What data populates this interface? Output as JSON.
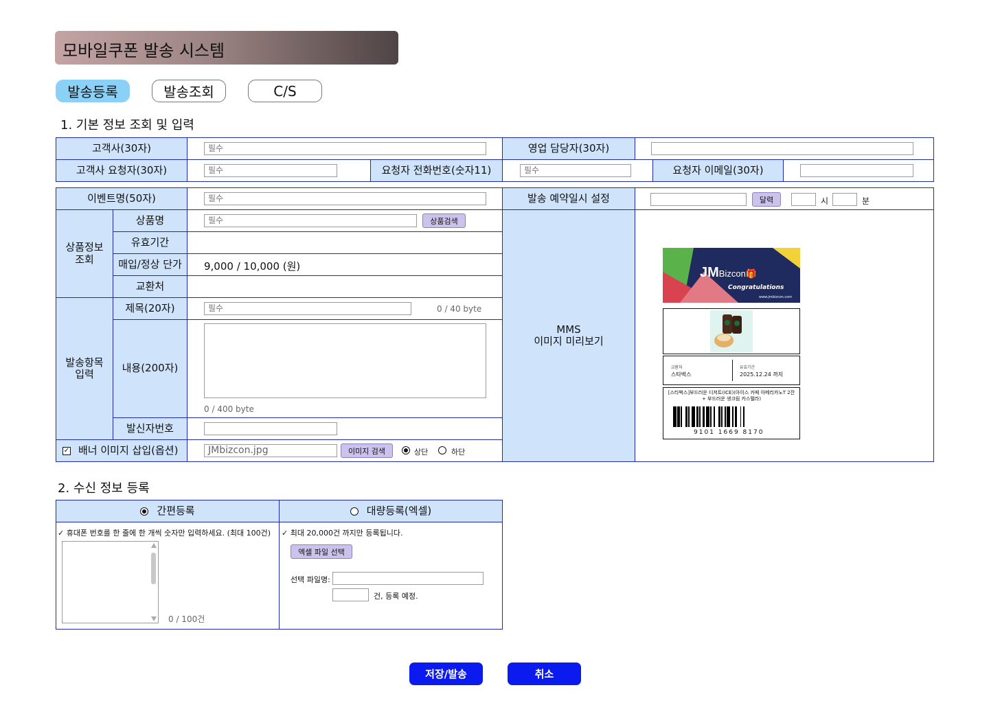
{
  "app": {
    "title": "모바일쿠폰 발송 시스템"
  },
  "tabs": [
    {
      "label": "발송등록",
      "active": true
    },
    {
      "label": "발송조회"
    },
    {
      "label": "C/S"
    }
  ],
  "section1": {
    "title": "1. 기본 정보 조회 및 입력"
  },
  "customer": {
    "company_label": "고객사(30자)",
    "company_placeholder": "필수",
    "sales_label": "영업 담당자(30자)",
    "sales_value": "",
    "requester_label": "고객사 요청자(30자)",
    "requester_placeholder": "필수",
    "phone_label": "요청자 전화번호(숫자11)",
    "phone_placeholder": "필수",
    "email_label": "요청자 이메일(30자)",
    "email_value": ""
  },
  "event": {
    "name_label": "이벤트명(50자)",
    "name_placeholder": "필수",
    "schedule_label": "발송 예약일시 설정",
    "calendar_button": "달력",
    "hour_label": "시",
    "minute_label": "분"
  },
  "product": {
    "group_label": "상품정보\n조회",
    "name_label": "상품명",
    "name_placeholder": "필수",
    "search_button": "상품검색",
    "validity_label": "유효기간",
    "validity_value": "",
    "price_label": "매입/정상 단가",
    "price_value": "9,000 / 10,000 (원)",
    "exchange_label": "교환처",
    "exchange_value": ""
  },
  "message": {
    "group_label": "발송항목\n입력",
    "subject_label": "제목(20자)",
    "subject_placeholder": "필수",
    "subject_counter": "0 / 40 byte",
    "content_label": "내용(200자)",
    "content_counter": "0 / 400 byte",
    "sender_label": "발신자번호",
    "sender_value": ""
  },
  "banner": {
    "label": "배너 이미지 삽입(옵션)",
    "checked": true,
    "file_value": "JMbizcon.jpg",
    "search_button": "이미지 검색",
    "top_label": "상단",
    "bottom_label": "하단",
    "position": "top"
  },
  "preview": {
    "label": "MMS\n이미지 미리보기",
    "brand_jm": "JM",
    "brand_biz": "Bizcon",
    "congrats": "Congratulations",
    "url": "www.jmbizcon.com",
    "exchange_title": "교환처",
    "exchange_value": "스타벅스",
    "validity_title": "유효기간",
    "validity_value": "2025.12.24 까지",
    "product_desc": "[스타벅스]부드러운 디저트(ICE)(아이스 카페 아메리카노T 2잔+ 부드러운 생크림 카스텔라)",
    "barcode_number": "9101 1669 8170"
  },
  "section2": {
    "title": "2. 수신 정보 등록"
  },
  "recipient": {
    "simple_label": "간편등록",
    "bulk_label": "대량등록(엑셀)",
    "mode": "simple",
    "simple_note": "✓ 휴대폰 번호를 한 줄에 한 개씩 숫자만 입력하세요. (최대 100건)",
    "simple_counter": "0 / 100건",
    "bulk_note": "✓ 최대 20,000건 까지만 등록됩니다.",
    "excel_button": "엑셀 파일 선택",
    "file_label": "선택 파일명:",
    "file_value": "",
    "count_value": "",
    "count_suffix": "건, 등록 예정."
  },
  "actions": {
    "save_label": "저장/발송",
    "cancel_label": "취소"
  },
  "colors": {
    "label_bg": "#cfe4fb",
    "border": "#1e2a9f",
    "primary": "#0b1bf0",
    "tab_active": "#8ad0f7",
    "button_small": "#cbc3ec"
  }
}
